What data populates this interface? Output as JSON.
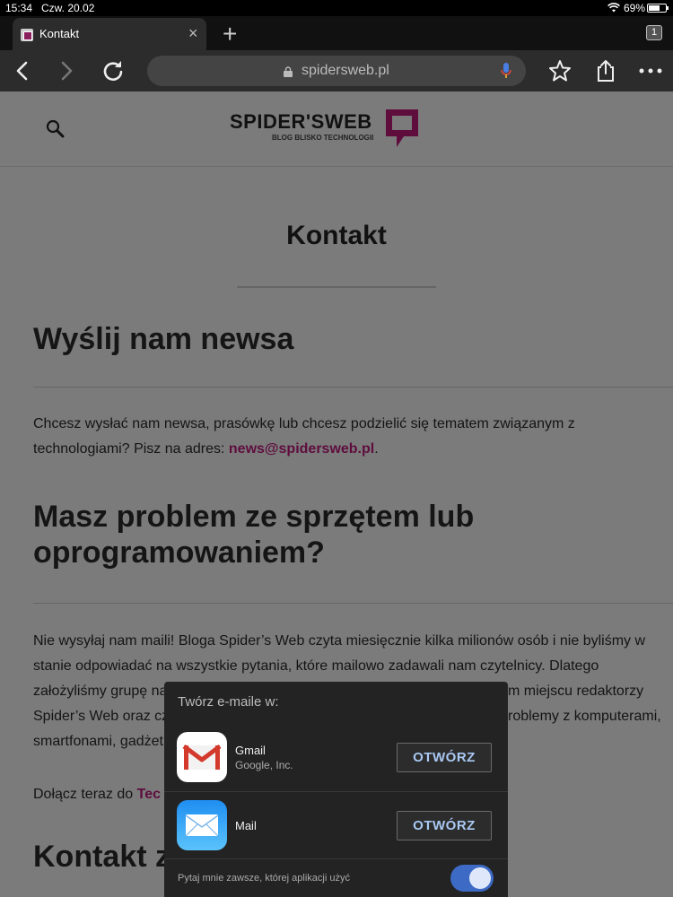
{
  "status_bar": {
    "time": "15:34",
    "date": "Czw. 20.02",
    "battery_percent_text": "69%",
    "battery_level": 0.69
  },
  "browser": {
    "tab_title": "Kontakt",
    "tab_close": "×",
    "new_tab": "+",
    "tab_count": "1",
    "url": "spidersweb.pl"
  },
  "site": {
    "logo_text": "SPIDER'SWEB",
    "logo_sub": "BLOG BLISKO TECHNOLOGII",
    "brand_color": "#8a1f5d"
  },
  "content": {
    "page_title": "Kontakt",
    "section1_heading": "Wyślij nam newsa",
    "section1_text": "Chcesz wysłać nam newsa, prasówkę lub chcesz podzielić się tematem związanym z technologiami? Pisz na adres: ",
    "section1_email": "news@spidersweb.pl",
    "section1_end": ".",
    "section2_heading": "Masz problem ze sprzętem lub oprogramowaniem?",
    "section2_line1": "Nie wysyłaj nam maili! Bloga Spider’s Web czyta miesięcznie kilka milionów osób i nie byliśmy w",
    "section2_line2": "stanie odpowiadać na wszystkie pytania, które mailowo zadawali nam czytelnicy. Dlatego",
    "section2_line3": "założyliśmy grupę na",
    "section2_line3_tail": "m miejscu redaktorzy",
    "section2_line4": "Spider’s Web oraz cz",
    "section2_line4_tail": "roblemy z komputerami,",
    "section2_line5": "smartfonami, gadżet",
    "join_text": "Dołącz teraz do ",
    "join_link": "Tec",
    "section3_heading": "Kontakt z"
  },
  "popup": {
    "title": "Twórz e-maile w:",
    "apps": [
      {
        "name": "Gmail",
        "publisher": "Google, Inc.",
        "button": "OTWÓRZ",
        "icon": "gmail-icon"
      },
      {
        "name": "Mail",
        "publisher": "",
        "button": "OTWÓRZ",
        "icon": "mail-icon"
      }
    ],
    "ask_label": "Pytaj mnie zawsze, której aplikacji użyć",
    "ask_toggle_on": true,
    "accent": "#a9c8f2"
  }
}
